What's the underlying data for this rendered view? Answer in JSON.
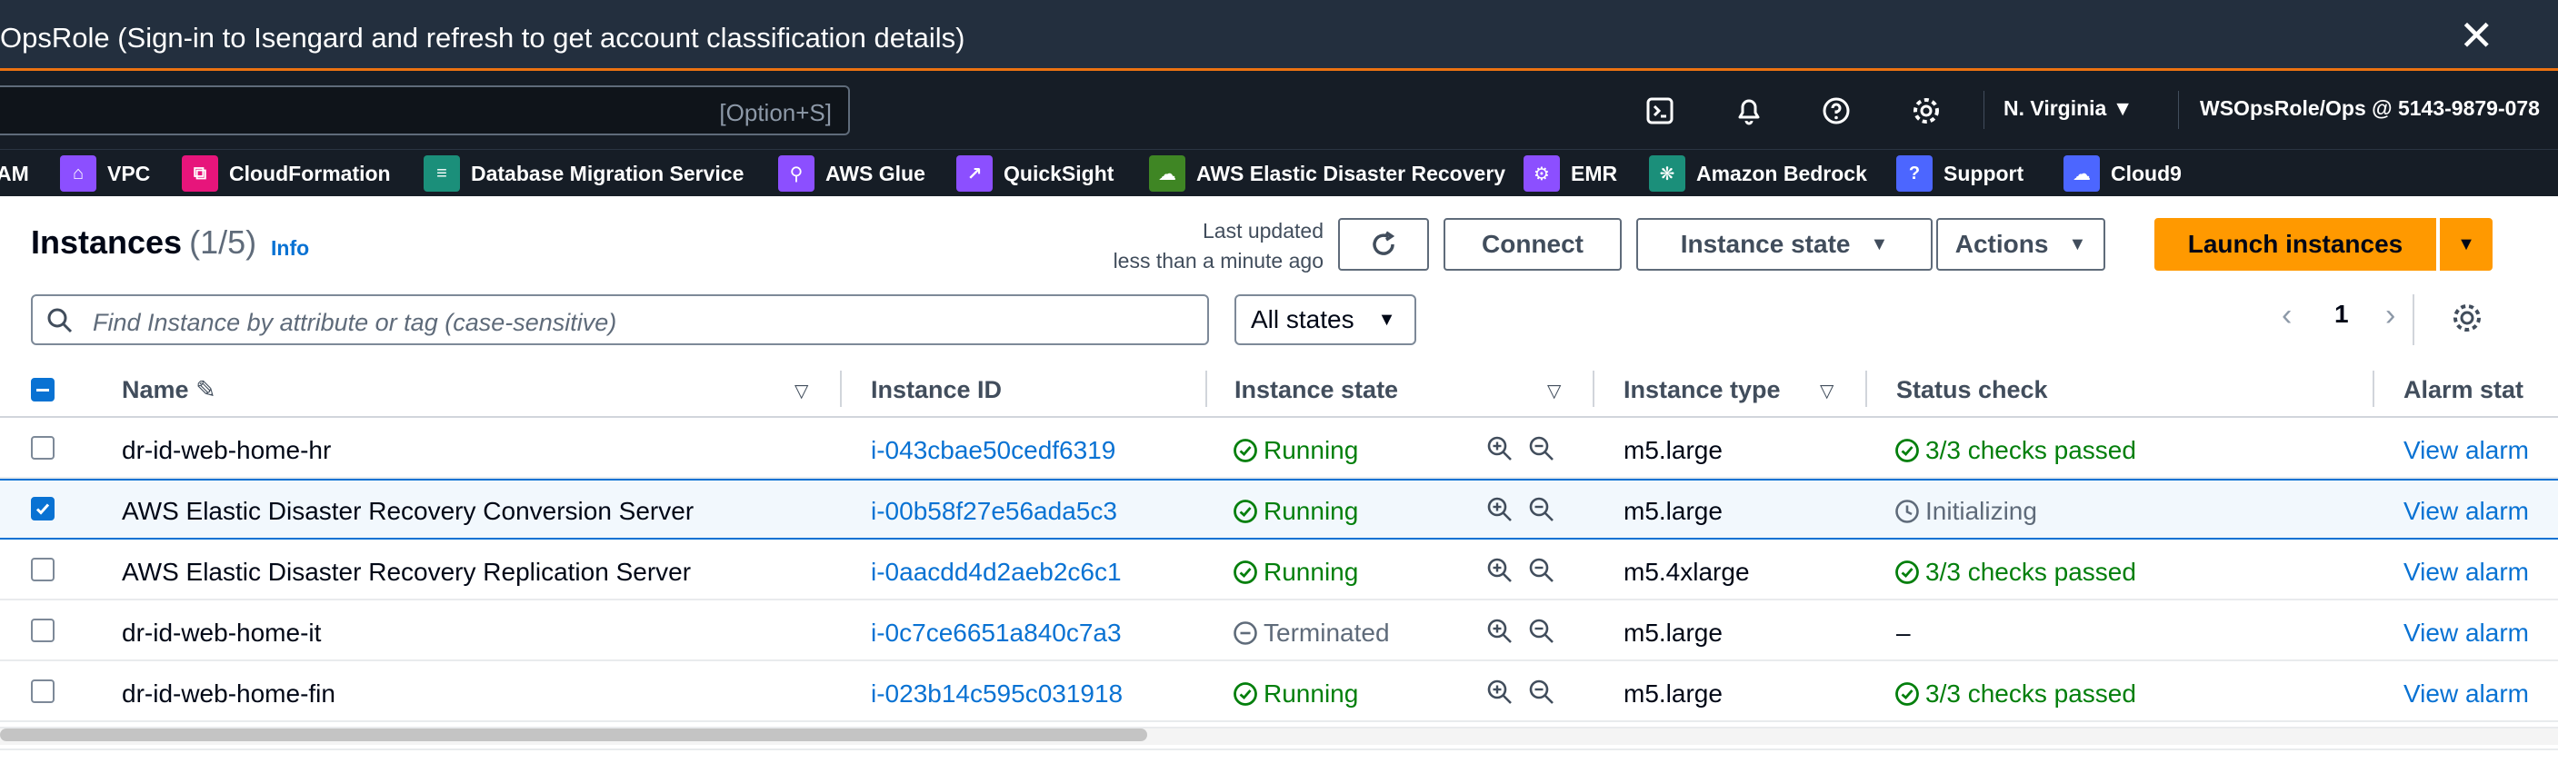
{
  "banner": {
    "text": "OpsRole (Sign-in to Isengard and refresh to get account classification details)",
    "close_icon": "✕"
  },
  "topnav": {
    "search_shortcut": "[Option+S]",
    "icons": [
      "cloudshell-icon",
      "notifications-icon",
      "help-icon",
      "settings-icon"
    ],
    "region": "N. Virginia ▼",
    "account": "WSOpsRole/Ops @ 5143-9879-078"
  },
  "favorites": [
    {
      "label": "AM",
      "color": "#8c4fff"
    },
    {
      "label": "VPC",
      "color": "#8c4fff"
    },
    {
      "label": "CloudFormation",
      "color": "#e7157b"
    },
    {
      "label": "Database Migration Service",
      "color": "#1b8f7a"
    },
    {
      "label": "AWS Glue",
      "color": "#8c4fff"
    },
    {
      "label": "QuickSight",
      "color": "#8c4fff"
    },
    {
      "label": "AWS Elastic Disaster Recovery",
      "color": "#3f8624"
    },
    {
      "label": "EMR",
      "color": "#8c4fff"
    },
    {
      "label": "Amazon Bedrock",
      "color": "#1b8f7a"
    },
    {
      "label": "Support",
      "color": "#4c66ff"
    },
    {
      "label": "Cloud9",
      "color": "#4c66ff"
    }
  ],
  "header": {
    "title": "Instances",
    "count": "(1/5)",
    "info": "Info",
    "last_updated_line1": "Last updated",
    "last_updated_line2": "less than a minute ago",
    "connect": "Connect",
    "instance_state": "Instance state",
    "actions": "Actions",
    "launch": "Launch instances"
  },
  "filter": {
    "placeholder": "Find Instance by attribute or tag (case-sensitive)",
    "states": "All states",
    "page": "1"
  },
  "columns": {
    "name": "Name",
    "instance_id": "Instance ID",
    "instance_state": "Instance state",
    "instance_type": "Instance type",
    "status_check": "Status check",
    "alarm_status": "Alarm stat"
  },
  "rows": [
    {
      "name": "dr-id-web-home-hr",
      "id": "i-043cbae50cedf6319",
      "state": "Running",
      "type": "m5.large",
      "status": "3/3 checks passed",
      "alarm": "View alarm",
      "selected": false
    },
    {
      "name": "AWS Elastic Disaster Recovery Conversion Server",
      "id": "i-00b58f27e56ada5c3",
      "state": "Running",
      "type": "m5.large",
      "status": "Initializing",
      "alarm": "View alarm",
      "selected": true
    },
    {
      "name": "AWS Elastic Disaster Recovery Replication Server",
      "id": "i-0aacdd4d2aeb2c6c1",
      "state": "Running",
      "type": "m5.4xlarge",
      "status": "3/3 checks passed",
      "alarm": "View alarm",
      "selected": false
    },
    {
      "name": "dr-id-web-home-it",
      "id": "i-0c7ce6651a840c7a3",
      "state": "Terminated",
      "type": "m5.large",
      "status": "–",
      "alarm": "View alarm",
      "selected": false
    },
    {
      "name": "dr-id-web-home-fin",
      "id": "i-023b14c595c031918",
      "state": "Running",
      "type": "m5.large",
      "status": "3/3 checks passed",
      "alarm": "View alarm",
      "selected": false
    }
  ]
}
